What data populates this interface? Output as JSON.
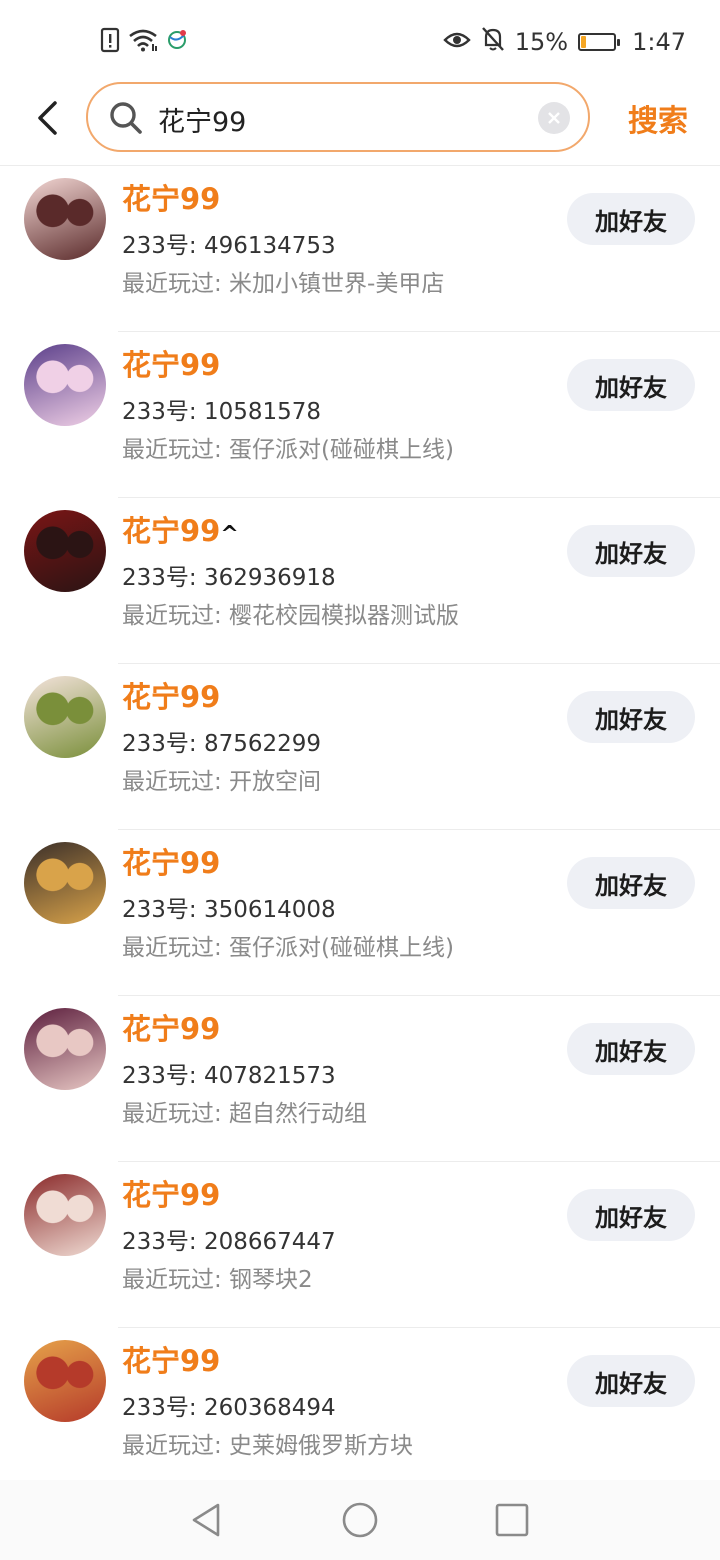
{
  "status_bar": {
    "battery_percent": "15%",
    "battery_level": 0.15,
    "time": "1:47",
    "icons": [
      "sim-alert-icon",
      "wifi-icon",
      "carrier-icon",
      "eye-icon",
      "bell-off-icon",
      "battery-icon"
    ]
  },
  "header": {
    "back_icon": "chevron-left-icon",
    "search_value": "花宁99",
    "search_action": "搜索"
  },
  "results": [
    {
      "name": "花宁99",
      "name_suffix": "",
      "uid": "233号: 496134753",
      "played": "最近玩过: 米加小镇世界-美甲店",
      "add_label": "加好友",
      "avatar_colors": [
        "#f3d7d4",
        "#5a2a2a"
      ]
    },
    {
      "name": "花宁99",
      "name_suffix": "",
      "uid": "233号: 10581578",
      "played": "最近玩过: 蛋仔派对(碰碰棋上线)",
      "add_label": "加好友",
      "avatar_colors": [
        "#5b3f8a",
        "#f0d0e6"
      ]
    },
    {
      "name": "花宁99",
      "name_suffix": "^",
      "uid": "233号: 362936918",
      "played": "最近玩过: 樱花校园模拟器测试版",
      "add_label": "加好友",
      "avatar_colors": [
        "#7a1515",
        "#2b1414"
      ]
    },
    {
      "name": "花宁99",
      "name_suffix": "",
      "uid": "233号: 87562299",
      "played": "最近玩过: 开放空间",
      "add_label": "加好友",
      "avatar_colors": [
        "#f4e3dc",
        "#7a8f3a"
      ]
    },
    {
      "name": "花宁99",
      "name_suffix": "",
      "uid": "233号: 350614008",
      "played": "最近玩过: 蛋仔派对(碰碰棋上线)",
      "add_label": "加好友",
      "avatar_colors": [
        "#3b2f29",
        "#d9a34a"
      ]
    },
    {
      "name": "花宁99",
      "name_suffix": "",
      "uid": "233号: 407821573",
      "played": "最近玩过: 超自然行动组",
      "add_label": "加好友",
      "avatar_colors": [
        "#5c1e3d",
        "#e8c8c4"
      ]
    },
    {
      "name": "花宁99",
      "name_suffix": "",
      "uid": "233号: 208667447",
      "played": "最近玩过: 钢琴块2",
      "add_label": "加好友",
      "avatar_colors": [
        "#8a2a2a",
        "#f0dcd4"
      ]
    },
    {
      "name": "花宁99",
      "name_suffix": "",
      "uid": "233号: 260368494",
      "played": "最近玩过: 史莱姆俄罗斯方块",
      "add_label": "加好友",
      "avatar_colors": [
        "#e6a24a",
        "#b53a2a"
      ]
    }
  ],
  "nav_bar": {
    "icons": [
      "back-triangle-icon",
      "home-circle-icon",
      "recents-square-icon"
    ]
  },
  "colors": {
    "accent": "#f07d1a",
    "search_border": "#f2a86c",
    "button_bg": "#eef0f5"
  }
}
